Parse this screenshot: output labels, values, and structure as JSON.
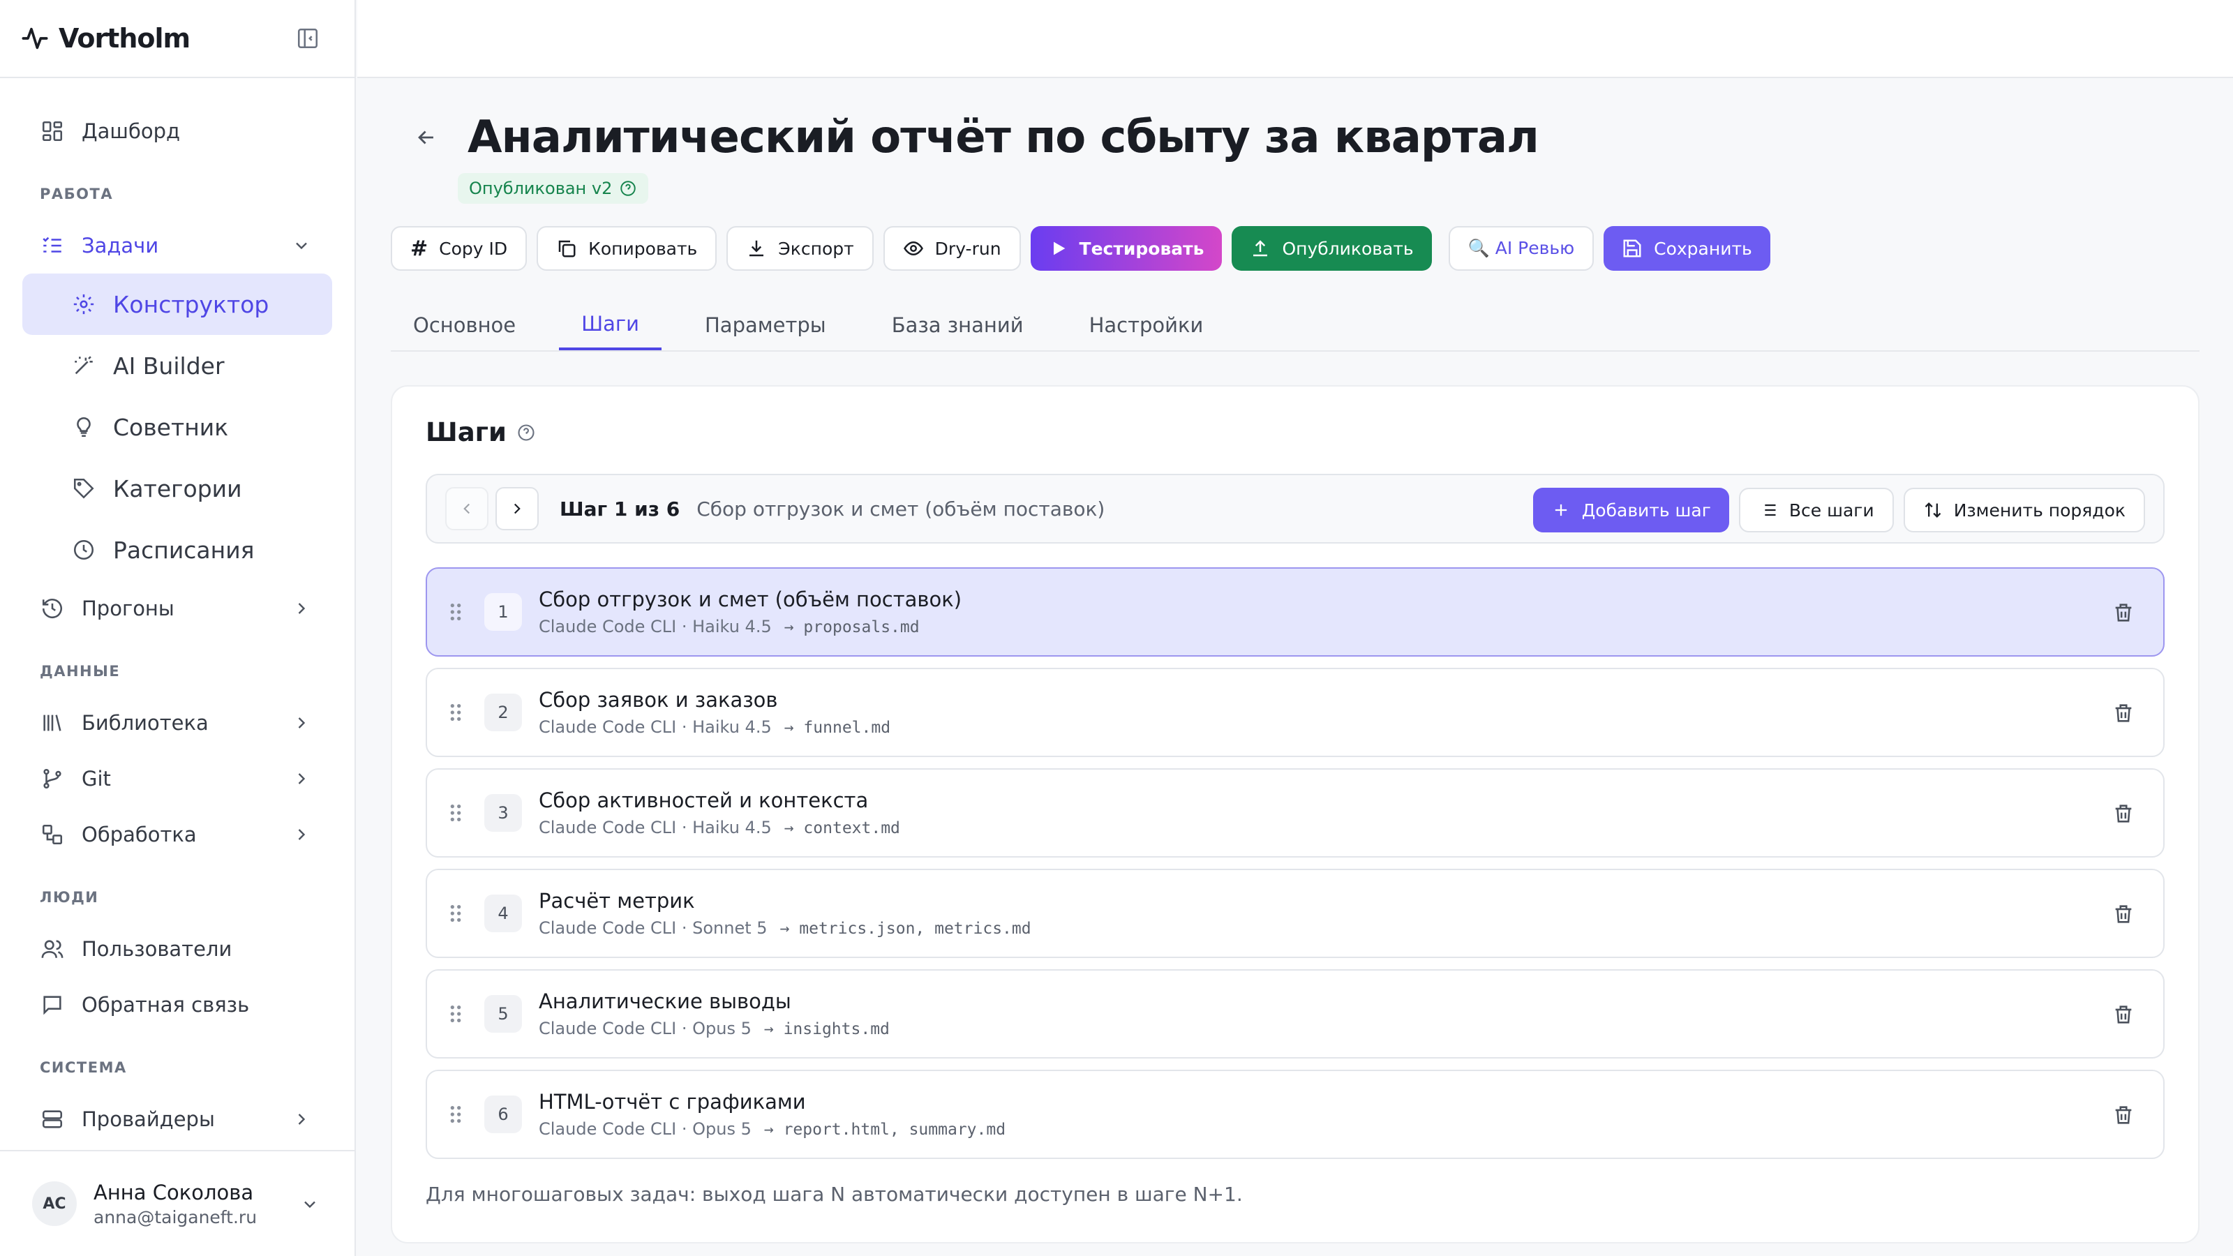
{
  "brand": {
    "name": "Vortholm"
  },
  "sidebar": {
    "top": [
      {
        "label": "Дашборд",
        "icon": "dashboard-icon"
      }
    ],
    "sections": {
      "work": "РАБОТА",
      "data": "ДАННЫЕ",
      "people": "ЛЮДИ",
      "system": "СИСТЕМА"
    },
    "tasks": "Задачи",
    "sub": [
      "Конструктор",
      "AI Builder",
      "Советник",
      "Категории",
      "Расписания"
    ],
    "runs": "Прогоны",
    "data_items": [
      "Библиотека",
      "Git",
      "Обработка"
    ],
    "people_items": [
      "Пользователи",
      "Обратная связь"
    ],
    "system_items": [
      "Провайдеры"
    ]
  },
  "user": {
    "initials": "АС",
    "name": "Анна Соколова",
    "email": "anna@taiganeft.ru"
  },
  "page": {
    "title": "Аналитический отчёт по сбыту за квартал",
    "badge": "Опубликован v2"
  },
  "toolbar": {
    "copy_id": "Copy ID",
    "copy": "Копировать",
    "export": "Экспорт",
    "dry_run": "Dry-run",
    "test": "Тестировать",
    "publish": "Опубликовать",
    "ai_review": "🔍 AI Ревью",
    "save": "Сохранить"
  },
  "tabs": [
    "Основное",
    "Шаги",
    "Параметры",
    "База знаний",
    "Настройки"
  ],
  "active_tab": "Шаги",
  "steps_card": {
    "title": "Шаги",
    "step_of": "Шаг 1 из 6",
    "current_name": "Сбор отгрузок и смет (объём поставок)",
    "add": "Добавить шаг",
    "all": "Все шаги",
    "reorder": "Изменить порядок",
    "footnote": "Для многошаговых задач: выход шага N автоматически доступен в шаге N+1."
  },
  "steps": [
    {
      "n": "1",
      "title": "Сбор отгрузок и смет (объём поставок)",
      "meta": "Claude Code CLI · Haiku 4.5",
      "out": "→ proposals.md"
    },
    {
      "n": "2",
      "title": "Сбор заявок и заказов",
      "meta": "Claude Code CLI · Haiku 4.5",
      "out": "→ funnel.md"
    },
    {
      "n": "3",
      "title": "Сбор активностей и контекста",
      "meta": "Claude Code CLI · Haiku 4.5",
      "out": "→ context.md"
    },
    {
      "n": "4",
      "title": "Расчёт метрик",
      "meta": "Claude Code CLI · Sonnet 5",
      "out": "→ metrics.json, metrics.md"
    },
    {
      "n": "5",
      "title": "Аналитические выводы",
      "meta": "Claude Code CLI · Opus 5",
      "out": "→ insights.md"
    },
    {
      "n": "6",
      "title": "HTML-отчёт с графиками",
      "meta": "Claude Code CLI · Opus 5",
      "out": "→ report.html, summary.md"
    }
  ],
  "colors": {
    "accent": "#4f46e5",
    "publish": "#178b52",
    "selected_bg": "#e4e6fd"
  }
}
